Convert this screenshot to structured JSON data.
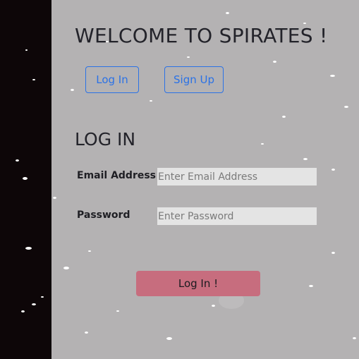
{
  "header": {
    "title": "WELCOME TO SPIRATES !"
  },
  "tabs": {
    "login_label": "Log In",
    "signup_label": "Sign Up"
  },
  "login_form": {
    "section_title": "LOG IN",
    "email": {
      "label": "Email Address",
      "value": "",
      "placeholder": "Enter Email Address"
    },
    "password": {
      "label": "Password",
      "value": "",
      "placeholder": "Enter Password"
    },
    "submit_label": "Log In !"
  },
  "colors": {
    "background": "#b4b2b3",
    "sidebar": "#0d0608",
    "accent_blue": "#2b72e6",
    "submit_pink": "#c76d7e",
    "input_bg": "#e4e4e4"
  }
}
